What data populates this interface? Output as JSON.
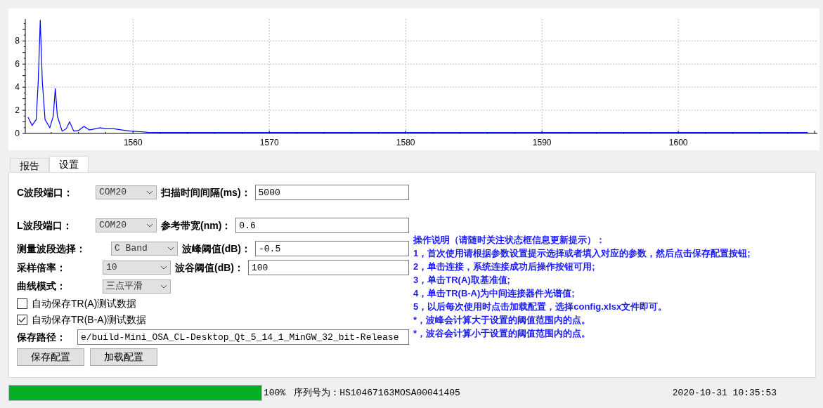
{
  "chart": {
    "chart_data": {
      "type": "line",
      "grid": true,
      "xlim": [
        1552.1,
        1610.2
      ],
      "ylim": [
        0,
        9.9
      ],
      "xticks": [
        1560,
        1570,
        1580,
        1590,
        1600
      ],
      "yticks": [
        0,
        2,
        4,
        6,
        8
      ],
      "series": [
        {
          "color": "#0000ff",
          "x": [
            1552.3,
            1552.6,
            1552.9,
            1553.05,
            1553.2,
            1553.35,
            1553.55,
            1553.9,
            1554.15,
            1554.3,
            1554.45,
            1554.8,
            1555.1,
            1555.35,
            1555.65,
            1556.0,
            1556.4,
            1556.8,
            1557.6,
            1558.0,
            1558.6,
            1559.2,
            1559.8,
            1560.5,
            1561.1,
            1562.1,
            1563.5,
            1565.7,
            1580,
            1609.5
          ],
          "values": [
            1.4,
            0.7,
            1.2,
            4.5,
            9.8,
            4.5,
            1.2,
            0.5,
            1.5,
            3.9,
            1.5,
            0.2,
            0.4,
            1.0,
            0.2,
            0.25,
            0.6,
            0.3,
            0.5,
            0.4,
            0.4,
            0.3,
            0.2,
            0.15,
            0.1,
            0.08,
            0.08,
            0.08,
            0.08,
            0.08
          ]
        }
      ]
    }
  },
  "tabs": [
    {
      "label": "报告",
      "selected": false
    },
    {
      "label": "设置",
      "selected": true
    }
  ],
  "settings": {
    "rows": [
      {
        "label": "C波段端口：",
        "select": "COM20",
        "field_label": "扫描时间间隔(ms)：",
        "value": "5000"
      },
      {
        "label": "L波段端口：",
        "select": "COM20",
        "field_label": "参考带宽(nm)：",
        "value": "0.6"
      },
      {
        "label": "测量波段选择：",
        "select": "C Band",
        "field_label": "波峰阈值(dB)：",
        "value": "-0.5"
      },
      {
        "label": "采样倍率：",
        "select": "10",
        "field_label": "波谷阈值(dB)：",
        "value": "100"
      }
    ],
    "curve_mode": {
      "label": "曲线模式：",
      "select": "三点平滑"
    },
    "checkboxes": [
      {
        "label": "自动保存TR(A)测试数据",
        "checked": false
      },
      {
        "label": "自动保存TR(B-A)测试数据",
        "checked": true
      }
    ],
    "save_path": {
      "label": "保存路径：",
      "value": "e/build-Mini_OSA_CL-Desktop_Qt_5_14_1_MinGW_32_bit-Release"
    },
    "buttons": [
      "保存配置",
      "加载配置"
    ]
  },
  "instructions": [
    "操作说明（请随时关注状态框信息更新提示）：",
    "1，首次使用请根据参数设置提示选择或者填入对应的参数，然后点击保存配置按钮;",
    "2，单击连接，系统连接成功后操作按钮可用;",
    "3，单击TR(A)取基准值;",
    "4，单击TR(B-A)为中间连接器件光谱值;",
    "5，以后每次使用时点击加载配置，选择config.xlsx文件即可。",
    "*，波峰会计算大于设置的阈值范围内的点。",
    "*，波谷会计算小于设置的阈值范围内的点。"
  ],
  "status_bar": {
    "progress": {
      "level": 1
    },
    "percent": "100%",
    "serial": "序列号为：HS10467163MOSA00041405",
    "datetime": "2020-10-31 10:35:53"
  }
}
